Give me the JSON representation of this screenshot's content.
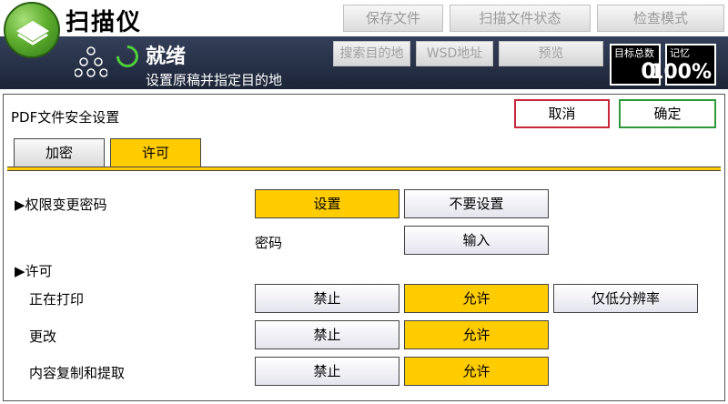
{
  "header": {
    "app_title": "扫描仪",
    "buttons": [
      "保存文件",
      "扫描文件状态",
      "检查模式"
    ]
  },
  "status": {
    "state": "就绪",
    "message": "设置原稿并指定目的地",
    "buttons": [
      "搜索目的地",
      "WSD地址",
      "预览"
    ],
    "counter_total_label": "目标总数",
    "counter_total_value": "0",
    "counter_memory_label": "记忆",
    "counter_memory_value": "100%"
  },
  "panel": {
    "title": "PDF文件安全设置",
    "cancel_label": "取消",
    "ok_label": "确定",
    "tabs": [
      "加密",
      "许可"
    ],
    "change_password": {
      "label": "▶权限变更密码",
      "options": [
        "设置",
        "不要设置"
      ],
      "password_label": "密码",
      "input_label": "输入"
    },
    "permissions": {
      "label": "▶许可",
      "rows": [
        {
          "label": "正在打印",
          "options": [
            "禁止",
            "允许",
            "仅低分辨率"
          ]
        },
        {
          "label": "更改",
          "options": [
            "禁止",
            "允许"
          ]
        },
        {
          "label": "内容复制和提取",
          "options": [
            "禁止",
            "允许"
          ]
        }
      ]
    }
  },
  "colors": {
    "selected": "#ffcc00",
    "status_band": "#1c2436",
    "cancel_border": "#c8283b",
    "ok_border": "#2d9a3a"
  }
}
